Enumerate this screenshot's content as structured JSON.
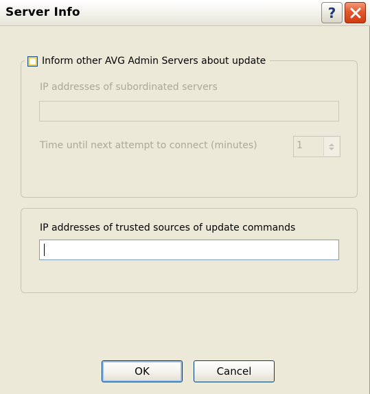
{
  "window": {
    "title": "Server Info",
    "help_glyph": "?",
    "close_icon": "close-icon"
  },
  "group_inform": {
    "checkbox_label": "Inform other AVG Admin Servers about update",
    "checkbox_checked": false,
    "subordinated_label": "IP addresses of subordinated servers",
    "subordinated_value": "",
    "time_label": "Time until next attempt to connect (minutes)",
    "time_value": "1"
  },
  "group_trusted": {
    "trusted_label": "IP addresses of trusted sources of update commands",
    "trusted_value": ""
  },
  "buttons": {
    "ok": "OK",
    "cancel": "Cancel"
  },
  "colors": {
    "window_bg": "#ece9d8",
    "accent_border": "#003c74",
    "close_red": "#e4582e",
    "disabled_text": "#aca899"
  }
}
